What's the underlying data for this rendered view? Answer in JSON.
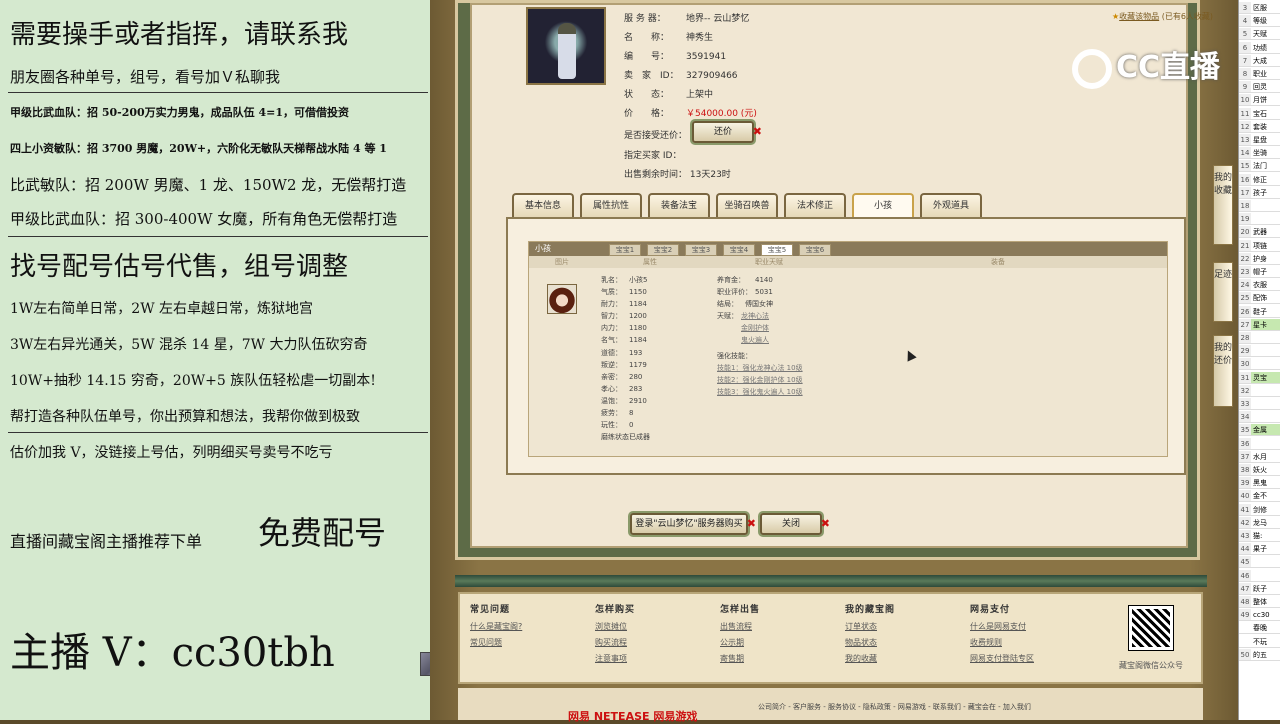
{
  "promo": {
    "lines": [
      "需要操手或者指挥，请联系我",
      "朋友圈各种单号，组号，看号加Ｖ私聊我",
      "甲级比武血队：招 50-200万实力男鬼，成品队伍 4=1，可借借投资",
      "四上小资敏队：招 3700 男魔，20W+，六阶化无敏队天梯帮战水陆 4 等 1",
      "比武敏队：招 200W 男魔、1 龙、150W2 龙，无偿帮打造",
      "甲级比武血队：招 300-400W 女魔，所有角色无偿帮打造",
      "找号配号估号代售，组号调整",
      "1W左右简单日常，2W 左右卓越日常，炼狱地宫",
      "3W左右异光通关，5W 混杀 14 星，7W 大力队伍砍穷奇",
      "10W+抽秒 14.15 穷奇，20W+5 族队伍轻松虐一切副本!",
      "帮打造各种队伍单号，你出预算和想法，我帮你做到极致",
      "估价加我 V，没链接上号估，列明细买号卖号不吃亏",
      "直播间藏宝阁主播推荐下单",
      "免费配号",
      "主播 V：cc30tbh"
    ]
  },
  "item": {
    "info_labels": [
      "服 务 器：",
      "名　　称：",
      "编　　号：",
      "卖　家　ID：",
      "状　　态：",
      "价　　格：",
      "是否接受还价：",
      "指定买家 ID：",
      "出售剩余时间："
    ],
    "server": "地界-- 云山梦忆",
    "name": "神秀生",
    "number": "3591941",
    "seller_id": "327909466",
    "status": "上架中",
    "price": "￥54000.00 (元)",
    "buyer_id": "",
    "remaining": "13天23时",
    "counter_offer_button": "还价",
    "favorite": "收藏该物品",
    "favorite_count": "(已有6人收藏)"
  },
  "tabs": [
    "基本信息",
    "属性抗性",
    "装备法宝",
    "坐骑召唤兽",
    "法术修正",
    "小孩",
    "外观道具"
  ],
  "active_tab": "小孩",
  "child_panel": {
    "title": "小孩",
    "subtabs": [
      "宝宝1",
      "宝宝2",
      "宝宝3",
      "宝宝4",
      "宝宝5",
      "宝宝6"
    ],
    "active_subtab": "宝宝5",
    "headers": [
      "图片",
      "属性",
      "职业天赋",
      "装备"
    ],
    "stats_labels": [
      "乳名：",
      "气质：",
      "耐力：",
      "智力：",
      "内力：",
      "名气：",
      "道德：",
      "叛逆：",
      "亲密：",
      "孝心：",
      "温饱：",
      "疲劳：",
      "玩性：",
      "磨练状态："
    ],
    "stats_values": [
      "小孩5",
      "1150",
      "1184",
      "1200",
      "1180",
      "1184",
      "193",
      "1179",
      "280",
      "283",
      "2910",
      "8",
      "0",
      "已成器"
    ],
    "right_labels": [
      "养育金：",
      "职业评价：",
      "结局：",
      "天赋："
    ],
    "right_values": [
      "4140",
      "5031",
      "傅国女神",
      "龙神心法"
    ],
    "talents_extra": [
      "金刚护体",
      "鬼火遍人"
    ],
    "skills_label": "强化技能：",
    "skills": [
      "技能1：强化龙神心法 10级",
      "技能2：强化金刚护体 10级",
      "技能3：强化鬼火遍人 10级"
    ]
  },
  "buttons": {
    "login_buy": "登录\"云山梦忆\"服务器购买",
    "close": "关闭"
  },
  "help": {
    "cols": [
      {
        "h": "常见问题",
        "items": [
          "什么是藏宝阁?",
          "常见问题"
        ]
      },
      {
        "h": "怎样购买",
        "items": [
          "浏览摊位",
          "购买流程",
          "注意事项"
        ]
      },
      {
        "h": "怎样出售",
        "items": [
          "出售流程",
          "公示期",
          "寄售期"
        ]
      },
      {
        "h": "我的藏宝阁",
        "items": [
          "订单状态",
          "物品状态",
          "我的收藏"
        ]
      },
      {
        "h": "网易支付",
        "items": [
          "什么是网易支付",
          "收费规则",
          "网易支付登陆专区"
        ]
      }
    ],
    "qr_caption": "藏宝阁微信公众号",
    "copyright": "公司简介 - 客户服务 - 服务协议 - 隐私政策 - 网易游戏 - 联系我们 - 藏宝会在 - 加入我们",
    "logo": "网易 NETEASE 网易游戏"
  },
  "side_buttons": [
    "我的收藏",
    "足迹",
    "我的还价"
  ],
  "watermark": "CC直播",
  "sheet_rows": [
    {
      "n": "3",
      "t": "区服"
    },
    {
      "n": "4",
      "t": "等级"
    },
    {
      "n": "5",
      "t": "天赋"
    },
    {
      "n": "6",
      "t": "功绩"
    },
    {
      "n": "7",
      "t": "大成"
    },
    {
      "n": "8",
      "t": "职业"
    },
    {
      "n": "9",
      "t": "回灵"
    },
    {
      "n": "10",
      "t": "月饼"
    },
    {
      "n": "11",
      "t": "宝石"
    },
    {
      "n": "12",
      "t": "套装"
    },
    {
      "n": "13",
      "t": "星盘"
    },
    {
      "n": "14",
      "t": "坐骑"
    },
    {
      "n": "15",
      "t": "法门"
    },
    {
      "n": "16",
      "t": "修正"
    },
    {
      "n": "17",
      "t": "孩子"
    },
    {
      "n": "18",
      "t": ""
    },
    {
      "n": "19",
      "t": ""
    },
    {
      "n": "20",
      "t": "武器"
    },
    {
      "n": "21",
      "t": "项链"
    },
    {
      "n": "22",
      "t": "护身"
    },
    {
      "n": "23",
      "t": "帽子"
    },
    {
      "n": "24",
      "t": "衣服"
    },
    {
      "n": "25",
      "t": "配饰"
    },
    {
      "n": "26",
      "t": "鞋子"
    },
    {
      "n": "27",
      "t": "星卡"
    },
    {
      "n": "28",
      "t": ""
    },
    {
      "n": "29",
      "t": ""
    },
    {
      "n": "30",
      "t": ""
    },
    {
      "n": "31",
      "t": "灵宝"
    },
    {
      "n": "32",
      "t": ""
    },
    {
      "n": "33",
      "t": ""
    },
    {
      "n": "34",
      "t": ""
    },
    {
      "n": "35",
      "t": "金属"
    },
    {
      "n": "36",
      "t": ""
    },
    {
      "n": "37",
      "t": "水月"
    },
    {
      "n": "38",
      "t": "妖火"
    },
    {
      "n": "39",
      "t": "黑鬼"
    },
    {
      "n": "40",
      "t": "金不"
    },
    {
      "n": "41",
      "t": "剑修"
    },
    {
      "n": "42",
      "t": "龙马"
    },
    {
      "n": "43",
      "t": "猫:"
    },
    {
      "n": "44",
      "t": "果子"
    },
    {
      "n": "45",
      "t": ""
    },
    {
      "n": "46",
      "t": ""
    },
    {
      "n": "47",
      "t": "跃子"
    },
    {
      "n": "48",
      "t": "整体"
    },
    {
      "n": "49",
      "t": "cc30"
    },
    {
      "n": "",
      "t": "春晚"
    },
    {
      "n": "",
      "t": "不玩"
    },
    {
      "n": "50",
      "t": "的五"
    }
  ]
}
